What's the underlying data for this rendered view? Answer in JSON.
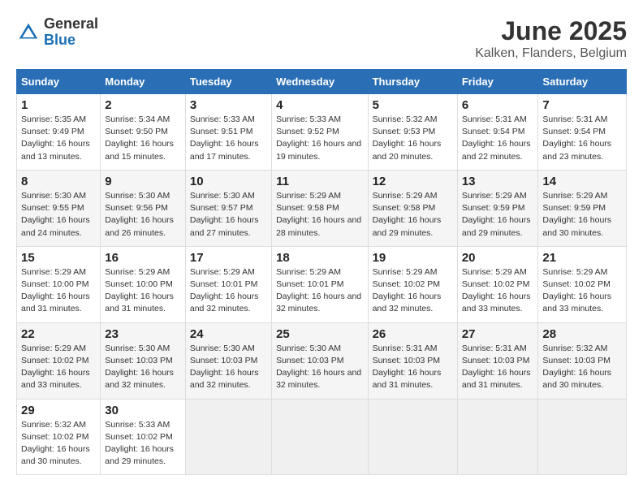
{
  "header": {
    "logo_general": "General",
    "logo_blue": "Blue",
    "title": "June 2025",
    "subtitle": "Kalken, Flanders, Belgium"
  },
  "calendar": {
    "weekdays": [
      "Sunday",
      "Monday",
      "Tuesday",
      "Wednesday",
      "Thursday",
      "Friday",
      "Saturday"
    ],
    "weeks": [
      [
        {
          "day": "1",
          "sunrise": "5:35 AM",
          "sunset": "9:49 PM",
          "daylight": "16 hours and 13 minutes."
        },
        {
          "day": "2",
          "sunrise": "5:34 AM",
          "sunset": "9:50 PM",
          "daylight": "16 hours and 15 minutes."
        },
        {
          "day": "3",
          "sunrise": "5:33 AM",
          "sunset": "9:51 PM",
          "daylight": "16 hours and 17 minutes."
        },
        {
          "day": "4",
          "sunrise": "5:33 AM",
          "sunset": "9:52 PM",
          "daylight": "16 hours and 19 minutes."
        },
        {
          "day": "5",
          "sunrise": "5:32 AM",
          "sunset": "9:53 PM",
          "daylight": "16 hours and 20 minutes."
        },
        {
          "day": "6",
          "sunrise": "5:31 AM",
          "sunset": "9:54 PM",
          "daylight": "16 hours and 22 minutes."
        },
        {
          "day": "7",
          "sunrise": "5:31 AM",
          "sunset": "9:54 PM",
          "daylight": "16 hours and 23 minutes."
        }
      ],
      [
        {
          "day": "8",
          "sunrise": "5:30 AM",
          "sunset": "9:55 PM",
          "daylight": "16 hours and 24 minutes."
        },
        {
          "day": "9",
          "sunrise": "5:30 AM",
          "sunset": "9:56 PM",
          "daylight": "16 hours and 26 minutes."
        },
        {
          "day": "10",
          "sunrise": "5:30 AM",
          "sunset": "9:57 PM",
          "daylight": "16 hours and 27 minutes."
        },
        {
          "day": "11",
          "sunrise": "5:29 AM",
          "sunset": "9:58 PM",
          "daylight": "16 hours and 28 minutes."
        },
        {
          "day": "12",
          "sunrise": "5:29 AM",
          "sunset": "9:58 PM",
          "daylight": "16 hours and 29 minutes."
        },
        {
          "day": "13",
          "sunrise": "5:29 AM",
          "sunset": "9:59 PM",
          "daylight": "16 hours and 29 minutes."
        },
        {
          "day": "14",
          "sunrise": "5:29 AM",
          "sunset": "9:59 PM",
          "daylight": "16 hours and 30 minutes."
        }
      ],
      [
        {
          "day": "15",
          "sunrise": "5:29 AM",
          "sunset": "10:00 PM",
          "daylight": "16 hours and 31 minutes."
        },
        {
          "day": "16",
          "sunrise": "5:29 AM",
          "sunset": "10:00 PM",
          "daylight": "16 hours and 31 minutes."
        },
        {
          "day": "17",
          "sunrise": "5:29 AM",
          "sunset": "10:01 PM",
          "daylight": "16 hours and 32 minutes."
        },
        {
          "day": "18",
          "sunrise": "5:29 AM",
          "sunset": "10:01 PM",
          "daylight": "16 hours and 32 minutes."
        },
        {
          "day": "19",
          "sunrise": "5:29 AM",
          "sunset": "10:02 PM",
          "daylight": "16 hours and 32 minutes."
        },
        {
          "day": "20",
          "sunrise": "5:29 AM",
          "sunset": "10:02 PM",
          "daylight": "16 hours and 33 minutes."
        },
        {
          "day": "21",
          "sunrise": "5:29 AM",
          "sunset": "10:02 PM",
          "daylight": "16 hours and 33 minutes."
        }
      ],
      [
        {
          "day": "22",
          "sunrise": "5:29 AM",
          "sunset": "10:02 PM",
          "daylight": "16 hours and 33 minutes."
        },
        {
          "day": "23",
          "sunrise": "5:30 AM",
          "sunset": "10:03 PM",
          "daylight": "16 hours and 32 minutes."
        },
        {
          "day": "24",
          "sunrise": "5:30 AM",
          "sunset": "10:03 PM",
          "daylight": "16 hours and 32 minutes."
        },
        {
          "day": "25",
          "sunrise": "5:30 AM",
          "sunset": "10:03 PM",
          "daylight": "16 hours and 32 minutes."
        },
        {
          "day": "26",
          "sunrise": "5:31 AM",
          "sunset": "10:03 PM",
          "daylight": "16 hours and 31 minutes."
        },
        {
          "day": "27",
          "sunrise": "5:31 AM",
          "sunset": "10:03 PM",
          "daylight": "16 hours and 31 minutes."
        },
        {
          "day": "28",
          "sunrise": "5:32 AM",
          "sunset": "10:03 PM",
          "daylight": "16 hours and 30 minutes."
        }
      ],
      [
        {
          "day": "29",
          "sunrise": "5:32 AM",
          "sunset": "10:02 PM",
          "daylight": "16 hours and 30 minutes."
        },
        {
          "day": "30",
          "sunrise": "5:33 AM",
          "sunset": "10:02 PM",
          "daylight": "16 hours and 29 minutes."
        },
        null,
        null,
        null,
        null,
        null
      ]
    ]
  }
}
